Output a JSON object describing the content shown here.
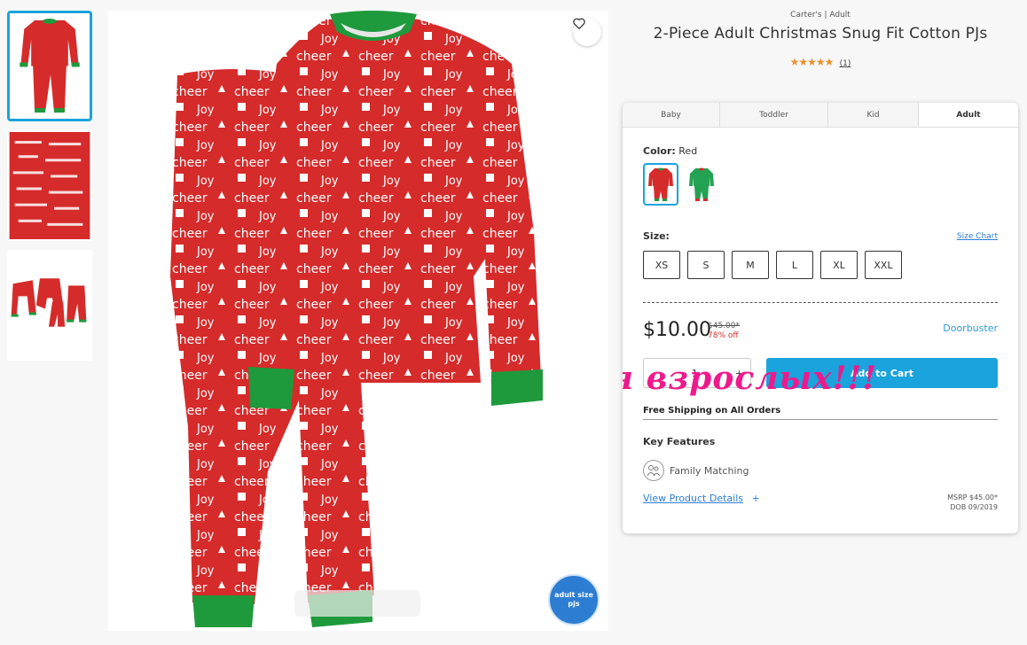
{
  "product": {
    "brand": "Carter's | Adult",
    "title": "2-Piece Adult Christmas Snug Fit Cotton PJs",
    "stars": "★★★★★",
    "review_count": "(1)",
    "rating": 5
  },
  "tabs": [
    "Baby",
    "Toddler",
    "Kid",
    "Adult"
  ],
  "color": {
    "label": "Color:",
    "value": "Red"
  },
  "size": {
    "label": "Size:",
    "chart_link": "Size Chart",
    "options": [
      "XS",
      "S",
      "M",
      "L",
      "XL",
      "XXL"
    ]
  },
  "pricing": {
    "price": "$10.00",
    "original": "$45.00*",
    "discount": "78% off",
    "promo": "Doorbuster"
  },
  "cart": {
    "minus": "-",
    "quantity": "1",
    "plus": "+",
    "button": "Add to Cart"
  },
  "overlay_text": "для взрослых!!!",
  "shipping": "Free Shipping on All Orders",
  "features": {
    "heading": "Key Features",
    "item": "Family Matching"
  },
  "details": {
    "link": "View Product Details",
    "plus": "+"
  },
  "msrp": {
    "line1": "MSRP $45.00*",
    "line2": "DOB 09/2019"
  },
  "badge": {
    "line1": "adult size",
    "line2": "pjs"
  },
  "colors": {
    "accent": "#1aa3dc",
    "pajama_red": "#d52b2b",
    "cuff_green": "#1e9a3c",
    "overlay_pink": "#ee1a8c",
    "star": "#e8912d"
  }
}
